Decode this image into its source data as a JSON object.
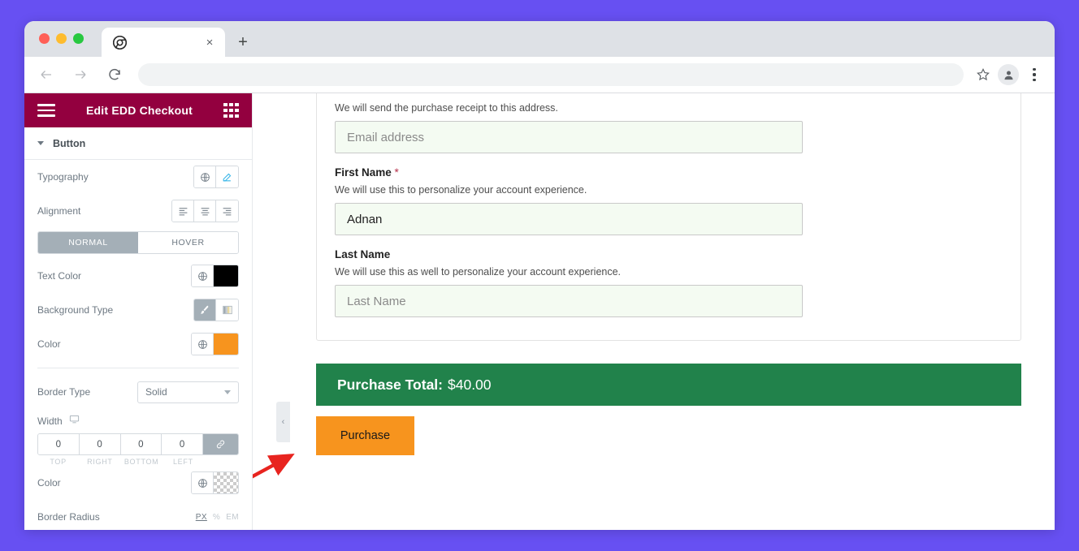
{
  "browser": {
    "tab": {
      "title": "",
      "favicon": "chrome-icon",
      "close": "×"
    },
    "new_tab": "+",
    "omnibox_value": "",
    "back": "←",
    "forward": "→",
    "reload": "↻"
  },
  "panel": {
    "title": "Edit EDD Checkout",
    "section": "Button",
    "controls": {
      "typography": "Typography",
      "alignment": "Alignment",
      "state_tabs": [
        "NORMAL",
        "HOVER"
      ],
      "text_color": "Text Color",
      "background_type": "Background Type",
      "color": "Color",
      "border_type": "Border Type",
      "border_type_value": "Solid",
      "width": "Width",
      "width_values": [
        "0",
        "0",
        "0",
        "0"
      ],
      "width_labels": [
        "TOP",
        "RIGHT",
        "BOTTOM",
        "LEFT"
      ],
      "border_color": "Color",
      "border_radius": "Border Radius",
      "units": [
        "PX",
        "%",
        "EM"
      ]
    },
    "colors": {
      "header_bg": "#93003f",
      "text_color_swatch": "#000000",
      "background_color_swatch": "#f7941e",
      "border_color_swatch": "transparent"
    },
    "collapse_handle": "‹"
  },
  "preview": {
    "email": {
      "help": "We will send the purchase receipt to this address.",
      "placeholder": "Email address",
      "value": ""
    },
    "first_name": {
      "label": "First Name",
      "required_mark": "*",
      "help": "We will use this to personalize your account experience.",
      "value": "Adnan"
    },
    "last_name": {
      "label": "Last Name",
      "help": "We will use this as well to personalize your account experience.",
      "placeholder": "Last Name",
      "value": ""
    },
    "total": {
      "label": "Purchase Total:",
      "amount": "$40.00",
      "bg": "#21824b"
    },
    "purchase_button": {
      "label": "Purchase",
      "bg": "#f7941e"
    }
  }
}
